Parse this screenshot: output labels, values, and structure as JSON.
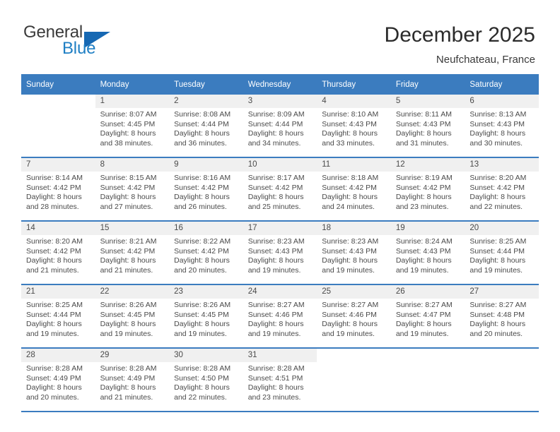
{
  "logo": {
    "text_primary": "General",
    "text_secondary": "Blue",
    "triangle_icon": "triangle-icon",
    "color_primary": "#3b3b3b",
    "color_secondary": "#1f7fc4",
    "color_triangle": "#1668b3"
  },
  "header": {
    "title": "December 2025",
    "subtitle": "Neufchateau, France",
    "accent_color": "#3b7cbf"
  },
  "calendar": {
    "weekday_headers": [
      "Sunday",
      "Monday",
      "Tuesday",
      "Wednesday",
      "Thursday",
      "Friday",
      "Saturday"
    ],
    "header_bg": "#3b7cbf",
    "daynum_band_bg": "#f0f0f0",
    "row_divider_color": "#3b7cbf",
    "weeks": [
      [
        {
          "day": "",
          "sunrise": "",
          "sunset": "",
          "daylight_line1": "",
          "daylight_line2": "",
          "empty": true
        },
        {
          "day": "1",
          "sunrise": "Sunrise: 8:07 AM",
          "sunset": "Sunset: 4:45 PM",
          "daylight_line1": "Daylight: 8 hours",
          "daylight_line2": "and 38 minutes.",
          "empty": false
        },
        {
          "day": "2",
          "sunrise": "Sunrise: 8:08 AM",
          "sunset": "Sunset: 4:44 PM",
          "daylight_line1": "Daylight: 8 hours",
          "daylight_line2": "and 36 minutes.",
          "empty": false
        },
        {
          "day": "3",
          "sunrise": "Sunrise: 8:09 AM",
          "sunset": "Sunset: 4:44 PM",
          "daylight_line1": "Daylight: 8 hours",
          "daylight_line2": "and 34 minutes.",
          "empty": false
        },
        {
          "day": "4",
          "sunrise": "Sunrise: 8:10 AM",
          "sunset": "Sunset: 4:43 PM",
          "daylight_line1": "Daylight: 8 hours",
          "daylight_line2": "and 33 minutes.",
          "empty": false
        },
        {
          "day": "5",
          "sunrise": "Sunrise: 8:11 AM",
          "sunset": "Sunset: 4:43 PM",
          "daylight_line1": "Daylight: 8 hours",
          "daylight_line2": "and 31 minutes.",
          "empty": false
        },
        {
          "day": "6",
          "sunrise": "Sunrise: 8:13 AM",
          "sunset": "Sunset: 4:43 PM",
          "daylight_line1": "Daylight: 8 hours",
          "daylight_line2": "and 30 minutes.",
          "empty": false
        }
      ],
      [
        {
          "day": "7",
          "sunrise": "Sunrise: 8:14 AM",
          "sunset": "Sunset: 4:42 PM",
          "daylight_line1": "Daylight: 8 hours",
          "daylight_line2": "and 28 minutes.",
          "empty": false
        },
        {
          "day": "8",
          "sunrise": "Sunrise: 8:15 AM",
          "sunset": "Sunset: 4:42 PM",
          "daylight_line1": "Daylight: 8 hours",
          "daylight_line2": "and 27 minutes.",
          "empty": false
        },
        {
          "day": "9",
          "sunrise": "Sunrise: 8:16 AM",
          "sunset": "Sunset: 4:42 PM",
          "daylight_line1": "Daylight: 8 hours",
          "daylight_line2": "and 26 minutes.",
          "empty": false
        },
        {
          "day": "10",
          "sunrise": "Sunrise: 8:17 AM",
          "sunset": "Sunset: 4:42 PM",
          "daylight_line1": "Daylight: 8 hours",
          "daylight_line2": "and 25 minutes.",
          "empty": false
        },
        {
          "day": "11",
          "sunrise": "Sunrise: 8:18 AM",
          "sunset": "Sunset: 4:42 PM",
          "daylight_line1": "Daylight: 8 hours",
          "daylight_line2": "and 24 minutes.",
          "empty": false
        },
        {
          "day": "12",
          "sunrise": "Sunrise: 8:19 AM",
          "sunset": "Sunset: 4:42 PM",
          "daylight_line1": "Daylight: 8 hours",
          "daylight_line2": "and 23 minutes.",
          "empty": false
        },
        {
          "day": "13",
          "sunrise": "Sunrise: 8:20 AM",
          "sunset": "Sunset: 4:42 PM",
          "daylight_line1": "Daylight: 8 hours",
          "daylight_line2": "and 22 minutes.",
          "empty": false
        }
      ],
      [
        {
          "day": "14",
          "sunrise": "Sunrise: 8:20 AM",
          "sunset": "Sunset: 4:42 PM",
          "daylight_line1": "Daylight: 8 hours",
          "daylight_line2": "and 21 minutes.",
          "empty": false
        },
        {
          "day": "15",
          "sunrise": "Sunrise: 8:21 AM",
          "sunset": "Sunset: 4:42 PM",
          "daylight_line1": "Daylight: 8 hours",
          "daylight_line2": "and 21 minutes.",
          "empty": false
        },
        {
          "day": "16",
          "sunrise": "Sunrise: 8:22 AM",
          "sunset": "Sunset: 4:42 PM",
          "daylight_line1": "Daylight: 8 hours",
          "daylight_line2": "and 20 minutes.",
          "empty": false
        },
        {
          "day": "17",
          "sunrise": "Sunrise: 8:23 AM",
          "sunset": "Sunset: 4:43 PM",
          "daylight_line1": "Daylight: 8 hours",
          "daylight_line2": "and 19 minutes.",
          "empty": false
        },
        {
          "day": "18",
          "sunrise": "Sunrise: 8:23 AM",
          "sunset": "Sunset: 4:43 PM",
          "daylight_line1": "Daylight: 8 hours",
          "daylight_line2": "and 19 minutes.",
          "empty": false
        },
        {
          "day": "19",
          "sunrise": "Sunrise: 8:24 AM",
          "sunset": "Sunset: 4:43 PM",
          "daylight_line1": "Daylight: 8 hours",
          "daylight_line2": "and 19 minutes.",
          "empty": false
        },
        {
          "day": "20",
          "sunrise": "Sunrise: 8:25 AM",
          "sunset": "Sunset: 4:44 PM",
          "daylight_line1": "Daylight: 8 hours",
          "daylight_line2": "and 19 minutes.",
          "empty": false
        }
      ],
      [
        {
          "day": "21",
          "sunrise": "Sunrise: 8:25 AM",
          "sunset": "Sunset: 4:44 PM",
          "daylight_line1": "Daylight: 8 hours",
          "daylight_line2": "and 19 minutes.",
          "empty": false
        },
        {
          "day": "22",
          "sunrise": "Sunrise: 8:26 AM",
          "sunset": "Sunset: 4:45 PM",
          "daylight_line1": "Daylight: 8 hours",
          "daylight_line2": "and 19 minutes.",
          "empty": false
        },
        {
          "day": "23",
          "sunrise": "Sunrise: 8:26 AM",
          "sunset": "Sunset: 4:45 PM",
          "daylight_line1": "Daylight: 8 hours",
          "daylight_line2": "and 19 minutes.",
          "empty": false
        },
        {
          "day": "24",
          "sunrise": "Sunrise: 8:27 AM",
          "sunset": "Sunset: 4:46 PM",
          "daylight_line1": "Daylight: 8 hours",
          "daylight_line2": "and 19 minutes.",
          "empty": false
        },
        {
          "day": "25",
          "sunrise": "Sunrise: 8:27 AM",
          "sunset": "Sunset: 4:46 PM",
          "daylight_line1": "Daylight: 8 hours",
          "daylight_line2": "and 19 minutes.",
          "empty": false
        },
        {
          "day": "26",
          "sunrise": "Sunrise: 8:27 AM",
          "sunset": "Sunset: 4:47 PM",
          "daylight_line1": "Daylight: 8 hours",
          "daylight_line2": "and 19 minutes.",
          "empty": false
        },
        {
          "day": "27",
          "sunrise": "Sunrise: 8:27 AM",
          "sunset": "Sunset: 4:48 PM",
          "daylight_line1": "Daylight: 8 hours",
          "daylight_line2": "and 20 minutes.",
          "empty": false
        }
      ],
      [
        {
          "day": "28",
          "sunrise": "Sunrise: 8:28 AM",
          "sunset": "Sunset: 4:49 PM",
          "daylight_line1": "Daylight: 8 hours",
          "daylight_line2": "and 20 minutes.",
          "empty": false
        },
        {
          "day": "29",
          "sunrise": "Sunrise: 8:28 AM",
          "sunset": "Sunset: 4:49 PM",
          "daylight_line1": "Daylight: 8 hours",
          "daylight_line2": "and 21 minutes.",
          "empty": false
        },
        {
          "day": "30",
          "sunrise": "Sunrise: 8:28 AM",
          "sunset": "Sunset: 4:50 PM",
          "daylight_line1": "Daylight: 8 hours",
          "daylight_line2": "and 22 minutes.",
          "empty": false
        },
        {
          "day": "31",
          "sunrise": "Sunrise: 8:28 AM",
          "sunset": "Sunset: 4:51 PM",
          "daylight_line1": "Daylight: 8 hours",
          "daylight_line2": "and 23 minutes.",
          "empty": false
        },
        {
          "day": "",
          "sunrise": "",
          "sunset": "",
          "daylight_line1": "",
          "daylight_line2": "",
          "empty": true
        },
        {
          "day": "",
          "sunrise": "",
          "sunset": "",
          "daylight_line1": "",
          "daylight_line2": "",
          "empty": true
        },
        {
          "day": "",
          "sunrise": "",
          "sunset": "",
          "daylight_line1": "",
          "daylight_line2": "",
          "empty": true
        }
      ]
    ]
  }
}
